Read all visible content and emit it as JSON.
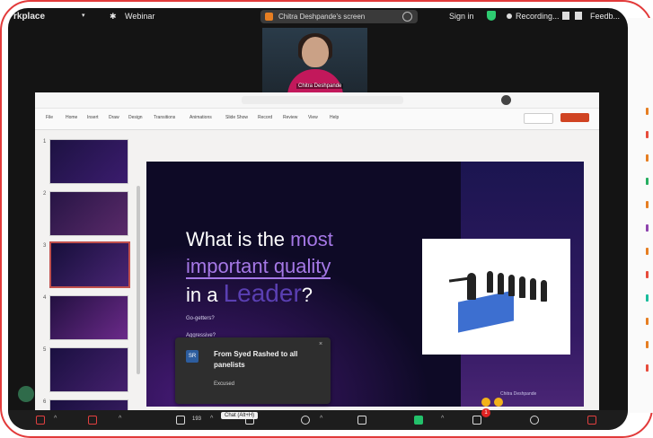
{
  "topbar": {
    "app_label": "rkplace",
    "webinar_label": "Webinar",
    "screen_title": "Chitra Deshpande's screen",
    "signin": "Sign in",
    "recording": "Recording...",
    "more": "Feedb..."
  },
  "video": {
    "participant_name": "Chitra Deshpande"
  },
  "ppt": {
    "menu": [
      "File",
      "Home",
      "Insert",
      "Draw",
      "Design",
      "Transitions",
      "Animations",
      "Slide Show",
      "Record",
      "Review",
      "View",
      "Help"
    ],
    "thumb_numbers": [
      "1",
      "2",
      "3",
      "4",
      "5",
      "6"
    ]
  },
  "slide": {
    "line1_a": "What is the ",
    "line1_b": "most",
    "line2": "important quality",
    "line3_a": "in a ",
    "line3_b": "Leader",
    "line3_c": "?",
    "bullet1": "Go-getters?",
    "bullet2": "Aggressive?",
    "footer": "Chitra Deshpande"
  },
  "toast": {
    "avatar": "SR",
    "header": "From Syed Rashed to all panelists",
    "message": "Excused",
    "close": "×"
  },
  "toolbar": {
    "attendee_count": "193",
    "tooltip": "Chat (Alt+H)",
    "chat_badge": "1"
  },
  "colors": {
    "frame_red": "#e23a3a",
    "slide_purple": "#a578e6",
    "share_green": "#23c16b"
  }
}
